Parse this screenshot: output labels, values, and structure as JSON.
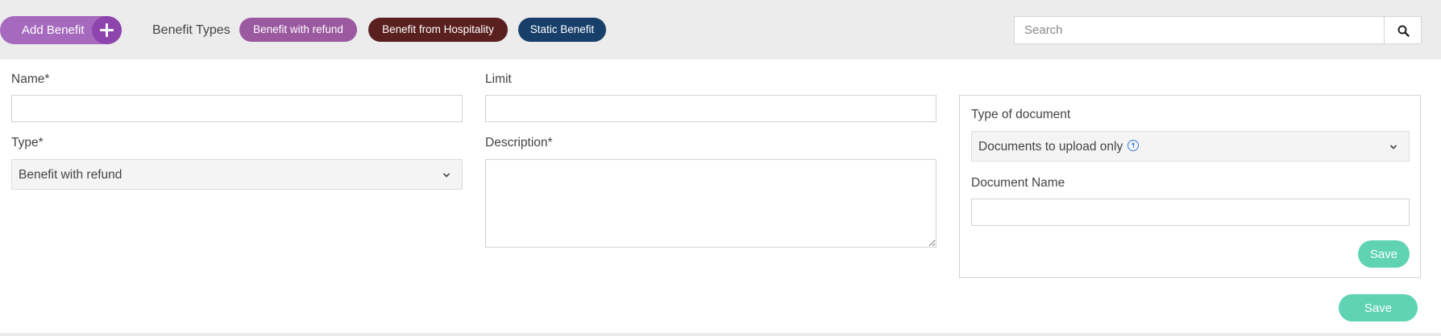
{
  "toolbar": {
    "add_benefit_label": "Add Benefit",
    "benefit_types_label": "Benefit Types",
    "types": [
      {
        "label": "Benefit with refund",
        "color": "#9b59a0"
      },
      {
        "label": "Benefit from Hospitality",
        "color": "#5a1f1f"
      },
      {
        "label": "Static Benefit",
        "color": "#173f6a"
      }
    ],
    "search": {
      "placeholder": "Search",
      "value": ""
    }
  },
  "form": {
    "name": {
      "label": "Name*",
      "value": ""
    },
    "limit": {
      "label": "Limit",
      "value": ""
    },
    "type": {
      "label": "Type*",
      "value": "Benefit with refund"
    },
    "description": {
      "label": "Description*",
      "value": ""
    },
    "document": {
      "type_label": "Type of document",
      "type_value": "Documents to upload only",
      "name_label": "Document Name",
      "name_value": "",
      "save_label": "Save"
    },
    "save_label": "Save"
  },
  "colors": {
    "accent_purple": "#a569bd",
    "save_green": "#5fd3b3"
  }
}
